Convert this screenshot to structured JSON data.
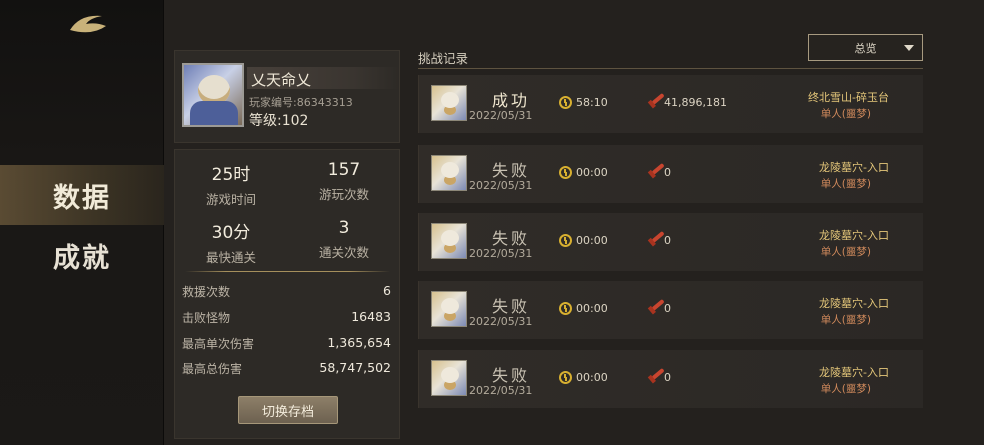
{
  "nav": {
    "items": [
      {
        "label": "数据"
      },
      {
        "label": "成就"
      }
    ]
  },
  "profile": {
    "name": "乂天命乂",
    "player_id": "玩家编号:86343313",
    "level": "等级:102"
  },
  "stats": {
    "play_time": {
      "value": "25时",
      "label": "游戏时间"
    },
    "play_count": {
      "value": "157",
      "label": "游玩次数"
    },
    "fastest_clear": {
      "value": "30分",
      "label": "最快通关"
    },
    "clear_count": {
      "value": "3",
      "label": "通关次数"
    },
    "details": [
      {
        "label": "救援次数",
        "value": "6"
      },
      {
        "label": "击败怪物",
        "value": "16483"
      },
      {
        "label": "最高单次伤害",
        "value": "1,365,654"
      },
      {
        "label": "最高总伤害",
        "value": "58,747,502"
      }
    ],
    "switch_button": "切换存档"
  },
  "records": {
    "title": "挑战记录",
    "filter": "总览",
    "items": [
      {
        "result": "成功",
        "date": "2022/05/31",
        "time": "58:10",
        "damage": "41,896,181",
        "stage": "终北雪山-碎玉台",
        "mode": "单人(噩梦)"
      },
      {
        "result": "失败",
        "date": "2022/05/31",
        "time": "00:00",
        "damage": "0",
        "stage": "龙陵墓穴-入口",
        "mode": "单人(噩梦)"
      },
      {
        "result": "失败",
        "date": "2022/05/31",
        "time": "00:00",
        "damage": "0",
        "stage": "龙陵墓穴-入口",
        "mode": "单人(噩梦)"
      },
      {
        "result": "失败",
        "date": "2022/05/31",
        "time": "00:00",
        "damage": "0",
        "stage": "龙陵墓穴-入口",
        "mode": "单人(噩梦)"
      },
      {
        "result": "失败",
        "date": "2022/05/31",
        "time": "00:00",
        "damage": "0",
        "stage": "龙陵墓穴-入口",
        "mode": "单人(噩梦)"
      }
    ]
  }
}
